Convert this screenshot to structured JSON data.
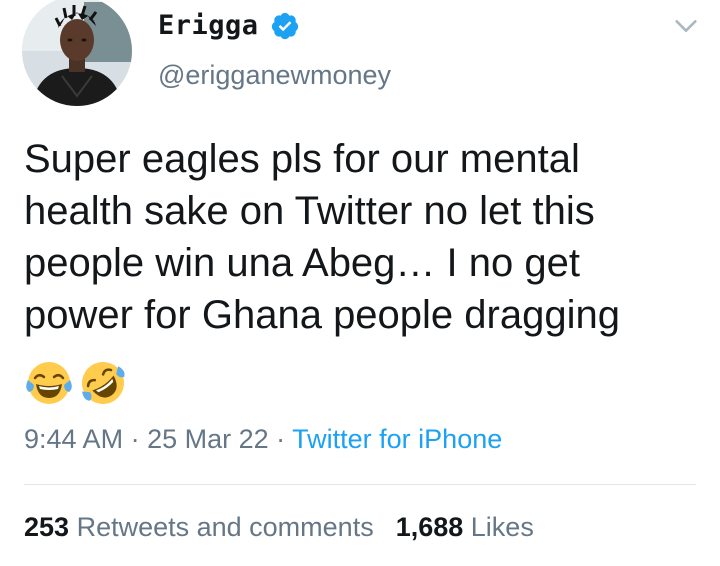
{
  "author": {
    "display_name": "Erigga",
    "handle": "@erigganewmoney",
    "verified": true
  },
  "tweet": {
    "lines": [
      "Super eagles pls for our mental",
      "health sake on Twitter no let this",
      "people win una Abeg… I no get",
      "power for Ghana people dragging"
    ],
    "emojis": [
      "face-with-tears-of-joy",
      "rolling-on-the-floor-laughing"
    ]
  },
  "meta": {
    "time": "9:44 AM",
    "separator": " · ",
    "date": "25 Mar 22",
    "source": "Twitter for iPhone"
  },
  "stats": {
    "retweets_count": "253",
    "retweets_label": " Retweets and comments",
    "likes_count": "1,688",
    "likes_label": " Likes"
  },
  "colors": {
    "accent": "#1da1f2",
    "secondary_text": "#657786",
    "divider": "#e1e8ed"
  },
  "icons": {
    "verified": "verified-badge-icon",
    "menu": "chevron-down-icon"
  }
}
